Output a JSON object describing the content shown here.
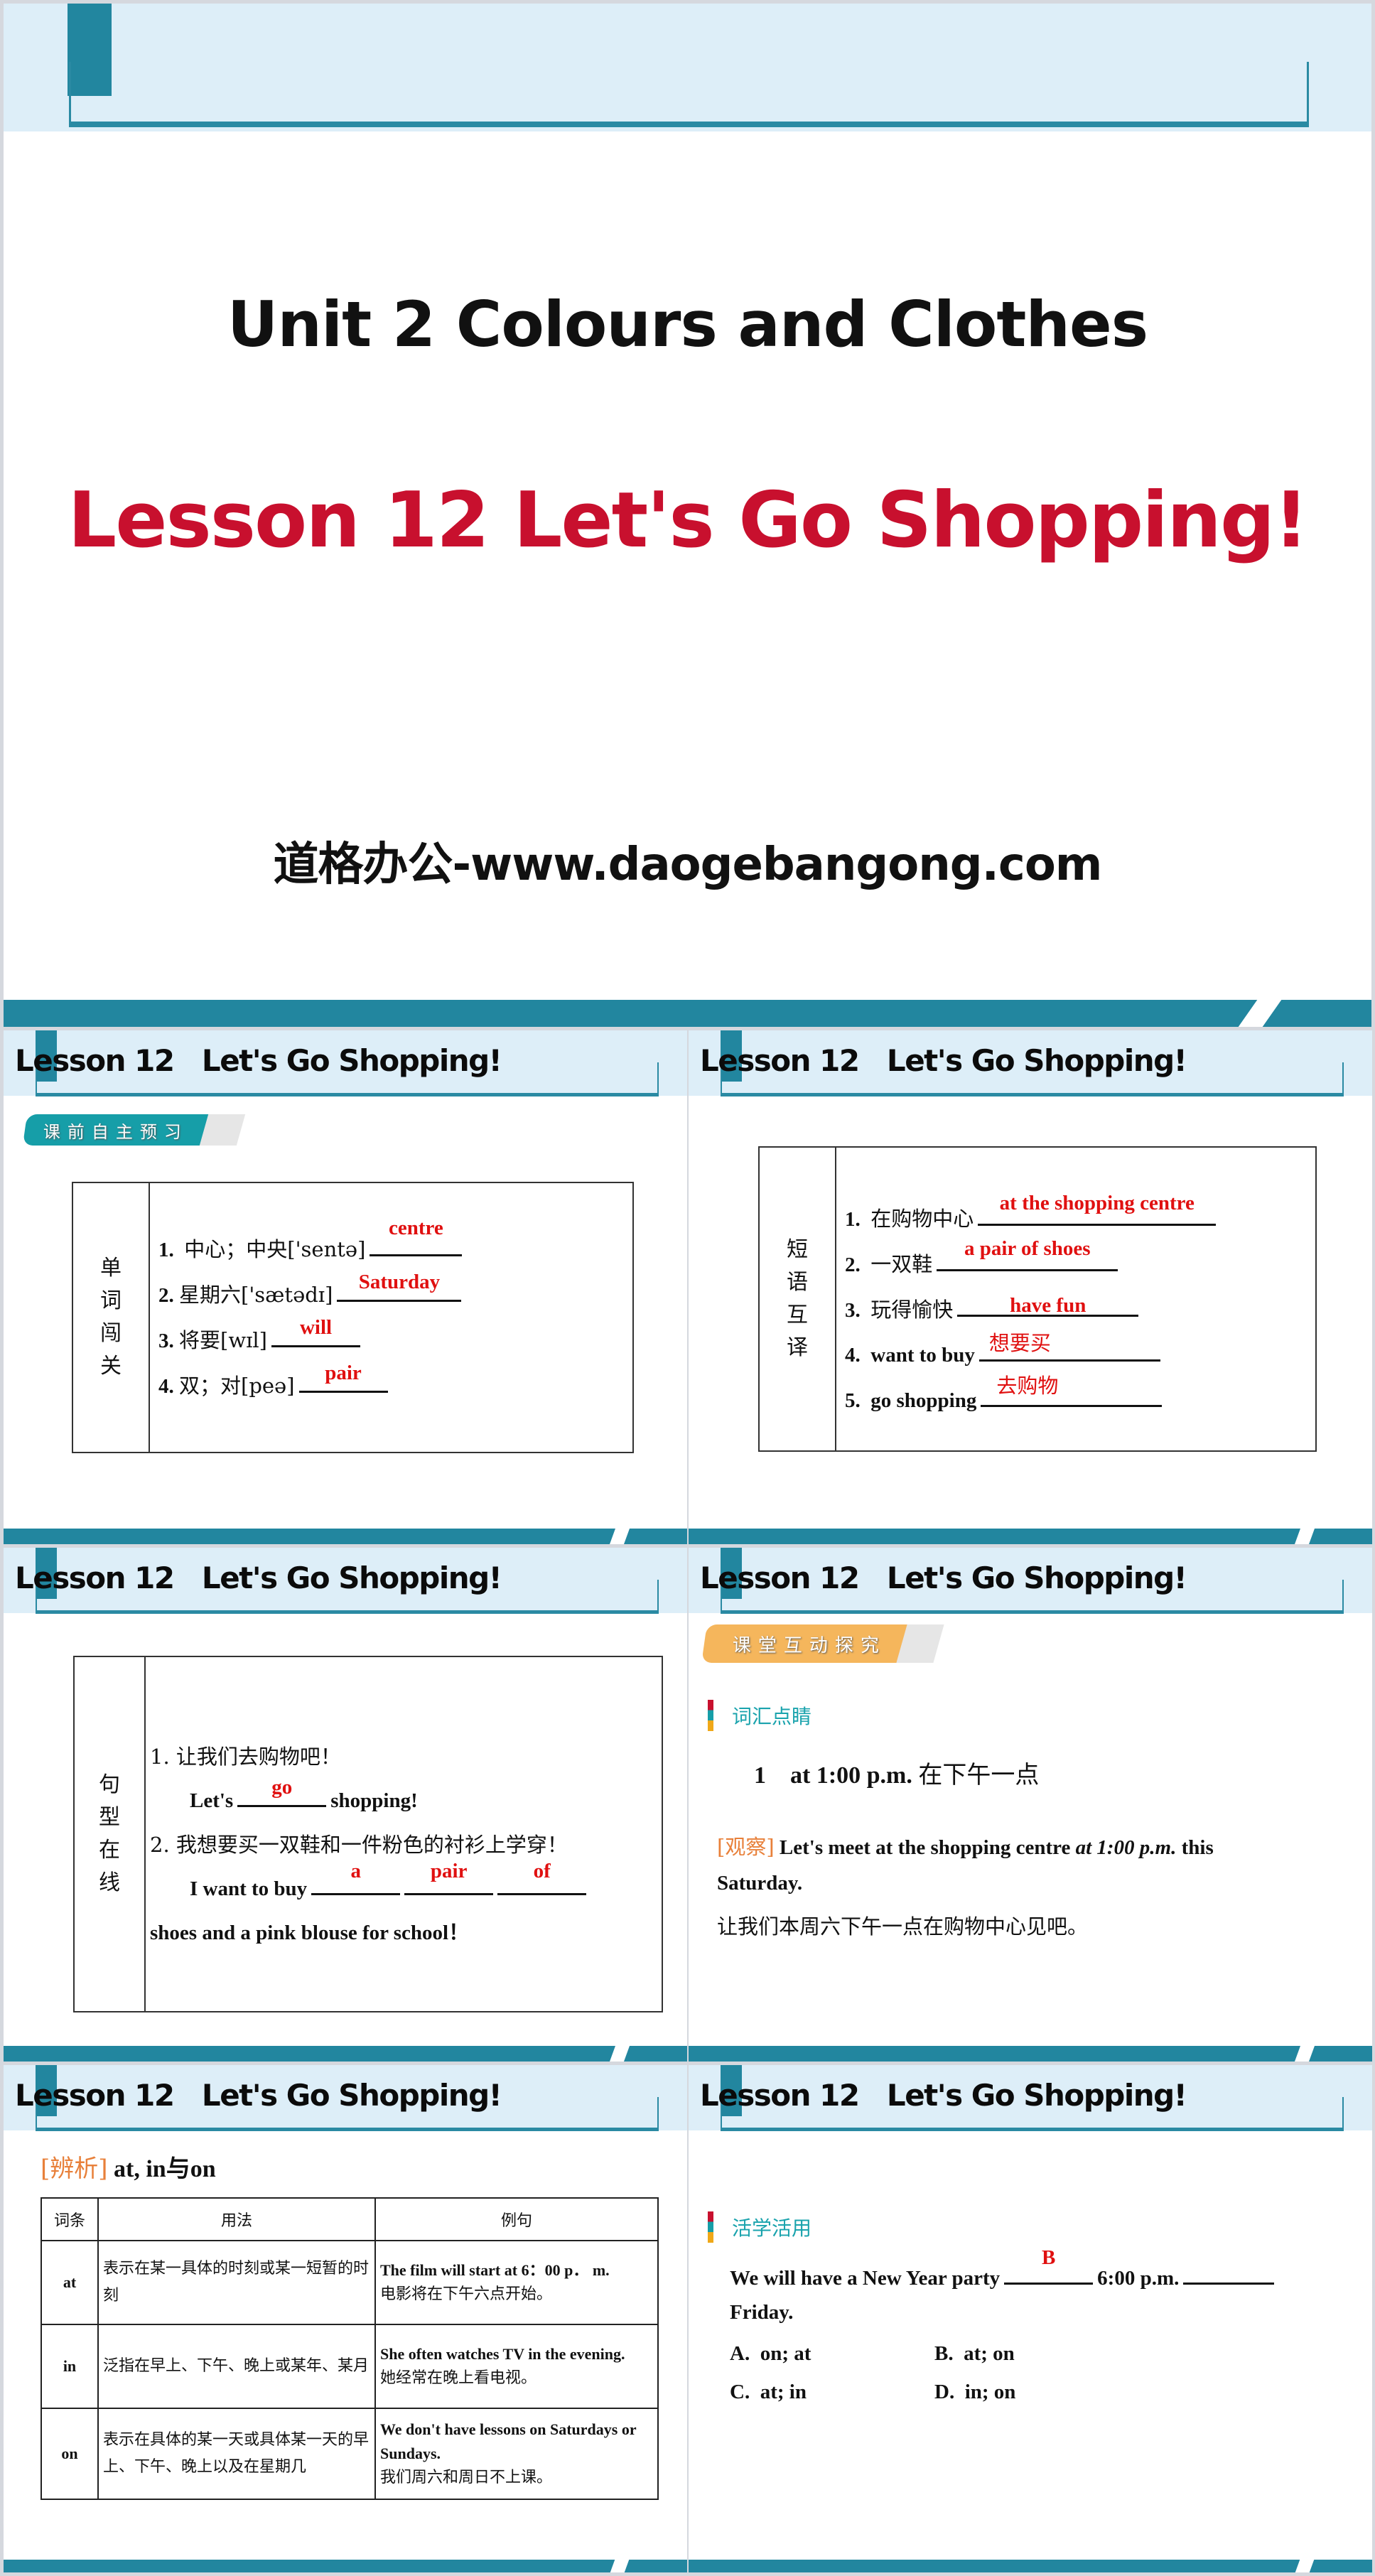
{
  "title_slide": {
    "unit_title": "Unit 2  Colours and Clothes",
    "lesson_title": "Lesson 12  Let's Go Shopping!",
    "site": "道格办公-www.daogebangong.com"
  },
  "slide_header": "Lesson 12   Let's Go Shopping!",
  "badges": {
    "preview": "课前自主预习",
    "classroom": "课堂互动探究"
  },
  "vocab_slide": {
    "section": [
      "单",
      "词",
      "闯",
      "关"
    ],
    "items": [
      {
        "num": "1.",
        "prompt": "中心；中央['sentə]",
        "answer": "centre"
      },
      {
        "num": "2.",
        "prompt": "星期六['sætədɪ]",
        "answer": "Saturday"
      },
      {
        "num": "3.",
        "prompt": "将要[wɪl]",
        "answer": "will"
      },
      {
        "num": "4.",
        "prompt": "双；对[peə]",
        "answer": "pair"
      }
    ]
  },
  "phrase_slide": {
    "section": [
      "短",
      "语",
      "互",
      "译"
    ],
    "items": [
      {
        "num": "1.",
        "prompt": "在购物中心",
        "answer": "at the shopping centre"
      },
      {
        "num": "2.",
        "prompt": "一双鞋",
        "answer": "a pair of shoes"
      },
      {
        "num": "3.",
        "prompt": "玩得愉快",
        "answer": "have fun"
      },
      {
        "num": "4.",
        "prompt": "want to buy",
        "answer": "想要买"
      },
      {
        "num": "5.",
        "prompt": "go shopping",
        "answer": "去购物"
      }
    ]
  },
  "sentence_slide": {
    "section": [
      "句",
      "型",
      "在",
      "线"
    ],
    "s1_cn": "1.  让我们去购物吧！",
    "s1_pre": "Let's",
    "s1_answer": "go",
    "s1_post": "shopping!",
    "s2_cn": "2.  我想要买一双鞋和一件粉色的衬衫上学穿！",
    "s2_pre": "I want to buy",
    "s2_answers": [
      "a",
      "pair",
      "of"
    ],
    "s2_cont": "shoes and a pink blouse for school！"
  },
  "explore_slide": {
    "marker": "词汇点睛",
    "point_num": "1",
    "point_en": "at 1:00 p.m.",
    "point_cn": "在下午一点",
    "observe_tag": "[观察]",
    "observe_pre": "Let's meet at the shopping centre",
    "observe_italic": "at 1:00 p.m.",
    "observe_post": "this",
    "observe_line2": "Saturday.",
    "observe_cn": "让我们本周六下午一点在购物中心见吧。"
  },
  "usage_slide": {
    "tag": "[辨析]",
    "title": "at, in与on",
    "headers": [
      "词条",
      "用法",
      "例句"
    ],
    "rows": [
      {
        "word": "at",
        "usage": "表示在某一具体的时刻或某一短暂的时刻",
        "example_en": "The film will start at 6：00 p． m.",
        "example_cn": "电影将在下午六点开始。"
      },
      {
        "word": "in",
        "usage": "泛指在早上、下午、晚上或某年、某月",
        "example_en": "She often watches TV in the evening.",
        "example_cn": "她经常在晚上看电视。"
      },
      {
        "word": "on",
        "usage": "表示在具体的某一天或具体某一天的早上、下午、晚上以及在星期几",
        "example_en": "We don't have lessons on Saturdays or Sundays.",
        "example_cn": "我们周六和周日不上课。"
      }
    ]
  },
  "practice_slide": {
    "marker": "活学活用",
    "q_pre": "We will have a New Year party",
    "q_answer": "B",
    "q_mid": "6:00 p.m.",
    "q_end": "Friday.",
    "options": [
      {
        "label": "A.",
        "text": "on; at"
      },
      {
        "label": "B.",
        "text": "at; on"
      },
      {
        "label": "C.",
        "text": "at; in"
      },
      {
        "label": "D.",
        "text": "in; on"
      }
    ]
  },
  "colors": {
    "teal": "#22869f",
    "header_bg": "#ddeef8",
    "title_red": "#c8102e",
    "answer_red": "#e01010",
    "marker_teal": "#1aa3ad",
    "tag_orange": "#e8803a",
    "badge_teal": "#169ea8",
    "badge_orange": "#f5b65c"
  }
}
